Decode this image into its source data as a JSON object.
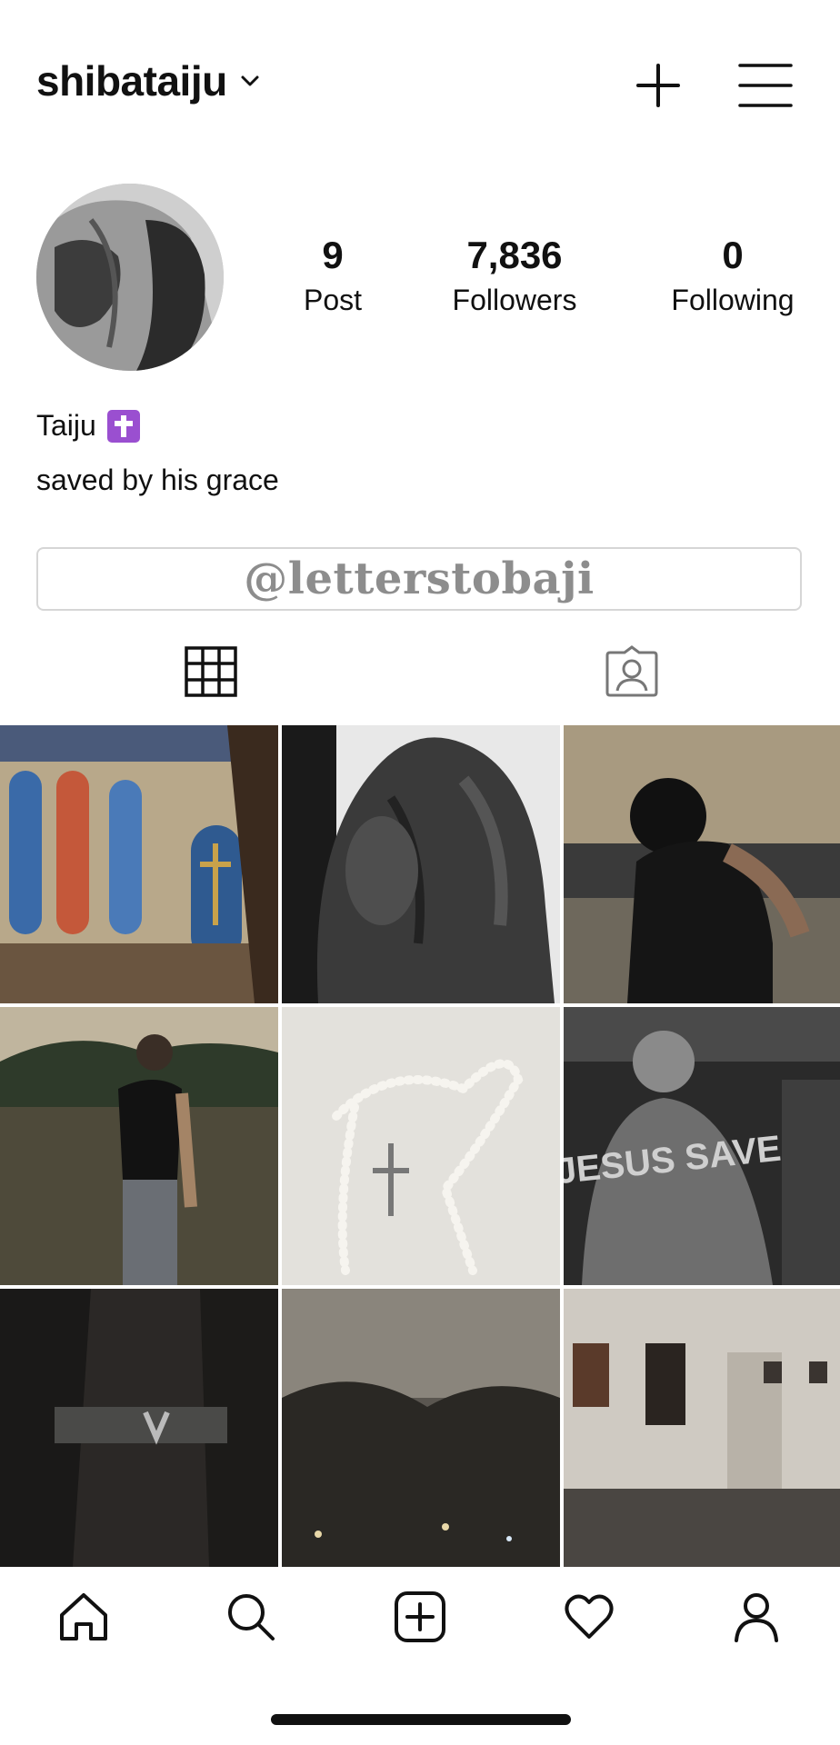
{
  "header": {
    "username": "shibataiju",
    "icons": {
      "dropdown": "chevron-down-icon",
      "new_post": "plus-icon",
      "menu": "hamburger-menu-icon"
    }
  },
  "profile": {
    "display_name": "Taiju",
    "name_emoji": "latin-cross-emoji",
    "bio": "saved by his grace",
    "stats": {
      "posts": {
        "value": "9",
        "label": "Post"
      },
      "followers": {
        "value": "7,836",
        "label": "Followers"
      },
      "following": {
        "value": "0",
        "label": "Following"
      }
    },
    "link_button": "@letterstobaji"
  },
  "tabs": [
    {
      "name": "grid",
      "icon": "grid-icon",
      "active": true
    },
    {
      "name": "tagged",
      "icon": "tagged-person-icon",
      "active": false
    }
  ],
  "posts": [
    {
      "description": "stained glass church interior"
    },
    {
      "description": "black and white muscular back"
    },
    {
      "description": "man on motorcycle with helmet"
    },
    {
      "description": "man in tank top in field at dusk"
    },
    {
      "description": "pearl rosary on white sheet"
    },
    {
      "description": "crowd with jacket reading",
      "text": "JESUS SAVES"
    },
    {
      "description": "dark coat and belt"
    },
    {
      "description": "blurred night city"
    },
    {
      "description": "art gallery interior"
    }
  ],
  "bottom_nav": [
    {
      "name": "home",
      "icon": "home-icon"
    },
    {
      "name": "search",
      "icon": "search-icon"
    },
    {
      "name": "create",
      "icon": "add-post-icon"
    },
    {
      "name": "activity",
      "icon": "heart-icon"
    },
    {
      "name": "profile",
      "icon": "profile-icon"
    }
  ],
  "colors": {
    "text": "#111111",
    "border": "#d6d6d6",
    "link_text": "#8d8d8d",
    "emoji_bg": "#9a4fd0"
  }
}
